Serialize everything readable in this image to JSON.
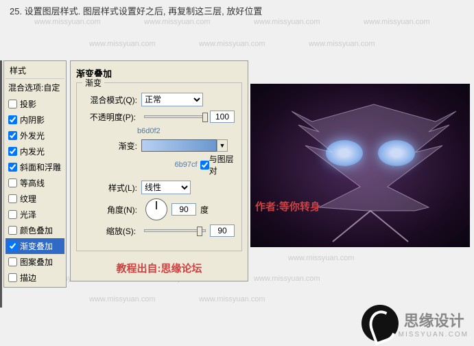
{
  "header": {
    "step_text": "25. 设置图层样式. 图层样式设置好之后, 再复制这三层, 放好位置"
  },
  "watermark": "www.missyuan.com",
  "left_panel": {
    "title": "样式",
    "blend_label": "混合选项:自定",
    "items": [
      {
        "label": "投影",
        "checked": false
      },
      {
        "label": "内阴影",
        "checked": true
      },
      {
        "label": "外发光",
        "checked": true
      },
      {
        "label": "内发光",
        "checked": true
      },
      {
        "label": "斜面和浮雕",
        "checked": true
      },
      {
        "label": "等高线",
        "checked": false
      },
      {
        "label": "纹理",
        "checked": false
      },
      {
        "label": "光泽",
        "checked": false
      },
      {
        "label": "颜色叠加",
        "checked": false
      },
      {
        "label": "渐变叠加",
        "checked": true,
        "active": true
      },
      {
        "label": "图案叠加",
        "checked": false
      },
      {
        "label": "描边",
        "checked": false
      }
    ]
  },
  "main": {
    "title": "渐变叠加",
    "group": "渐变",
    "blend_mode_label": "混合模式(Q):",
    "blend_mode_value": "正常",
    "opacity_label": "不透明度(P):",
    "opacity_value": "100",
    "gradient_label": "渐变:",
    "color1": "b6d0f2",
    "color2": "6b97cf",
    "align_label": "与图层对",
    "style_label": "样式(L):",
    "style_value": "线性",
    "angle_label": "角度(N):",
    "angle_value": "90",
    "angle_unit": "度",
    "scale_label": "缩放(S):",
    "scale_value": "90",
    "credit": "教程出自:思缘论坛"
  },
  "author": "作者:等你转身",
  "logo": {
    "main": "思缘设计",
    "sub": "MISSYUAN.COM"
  }
}
